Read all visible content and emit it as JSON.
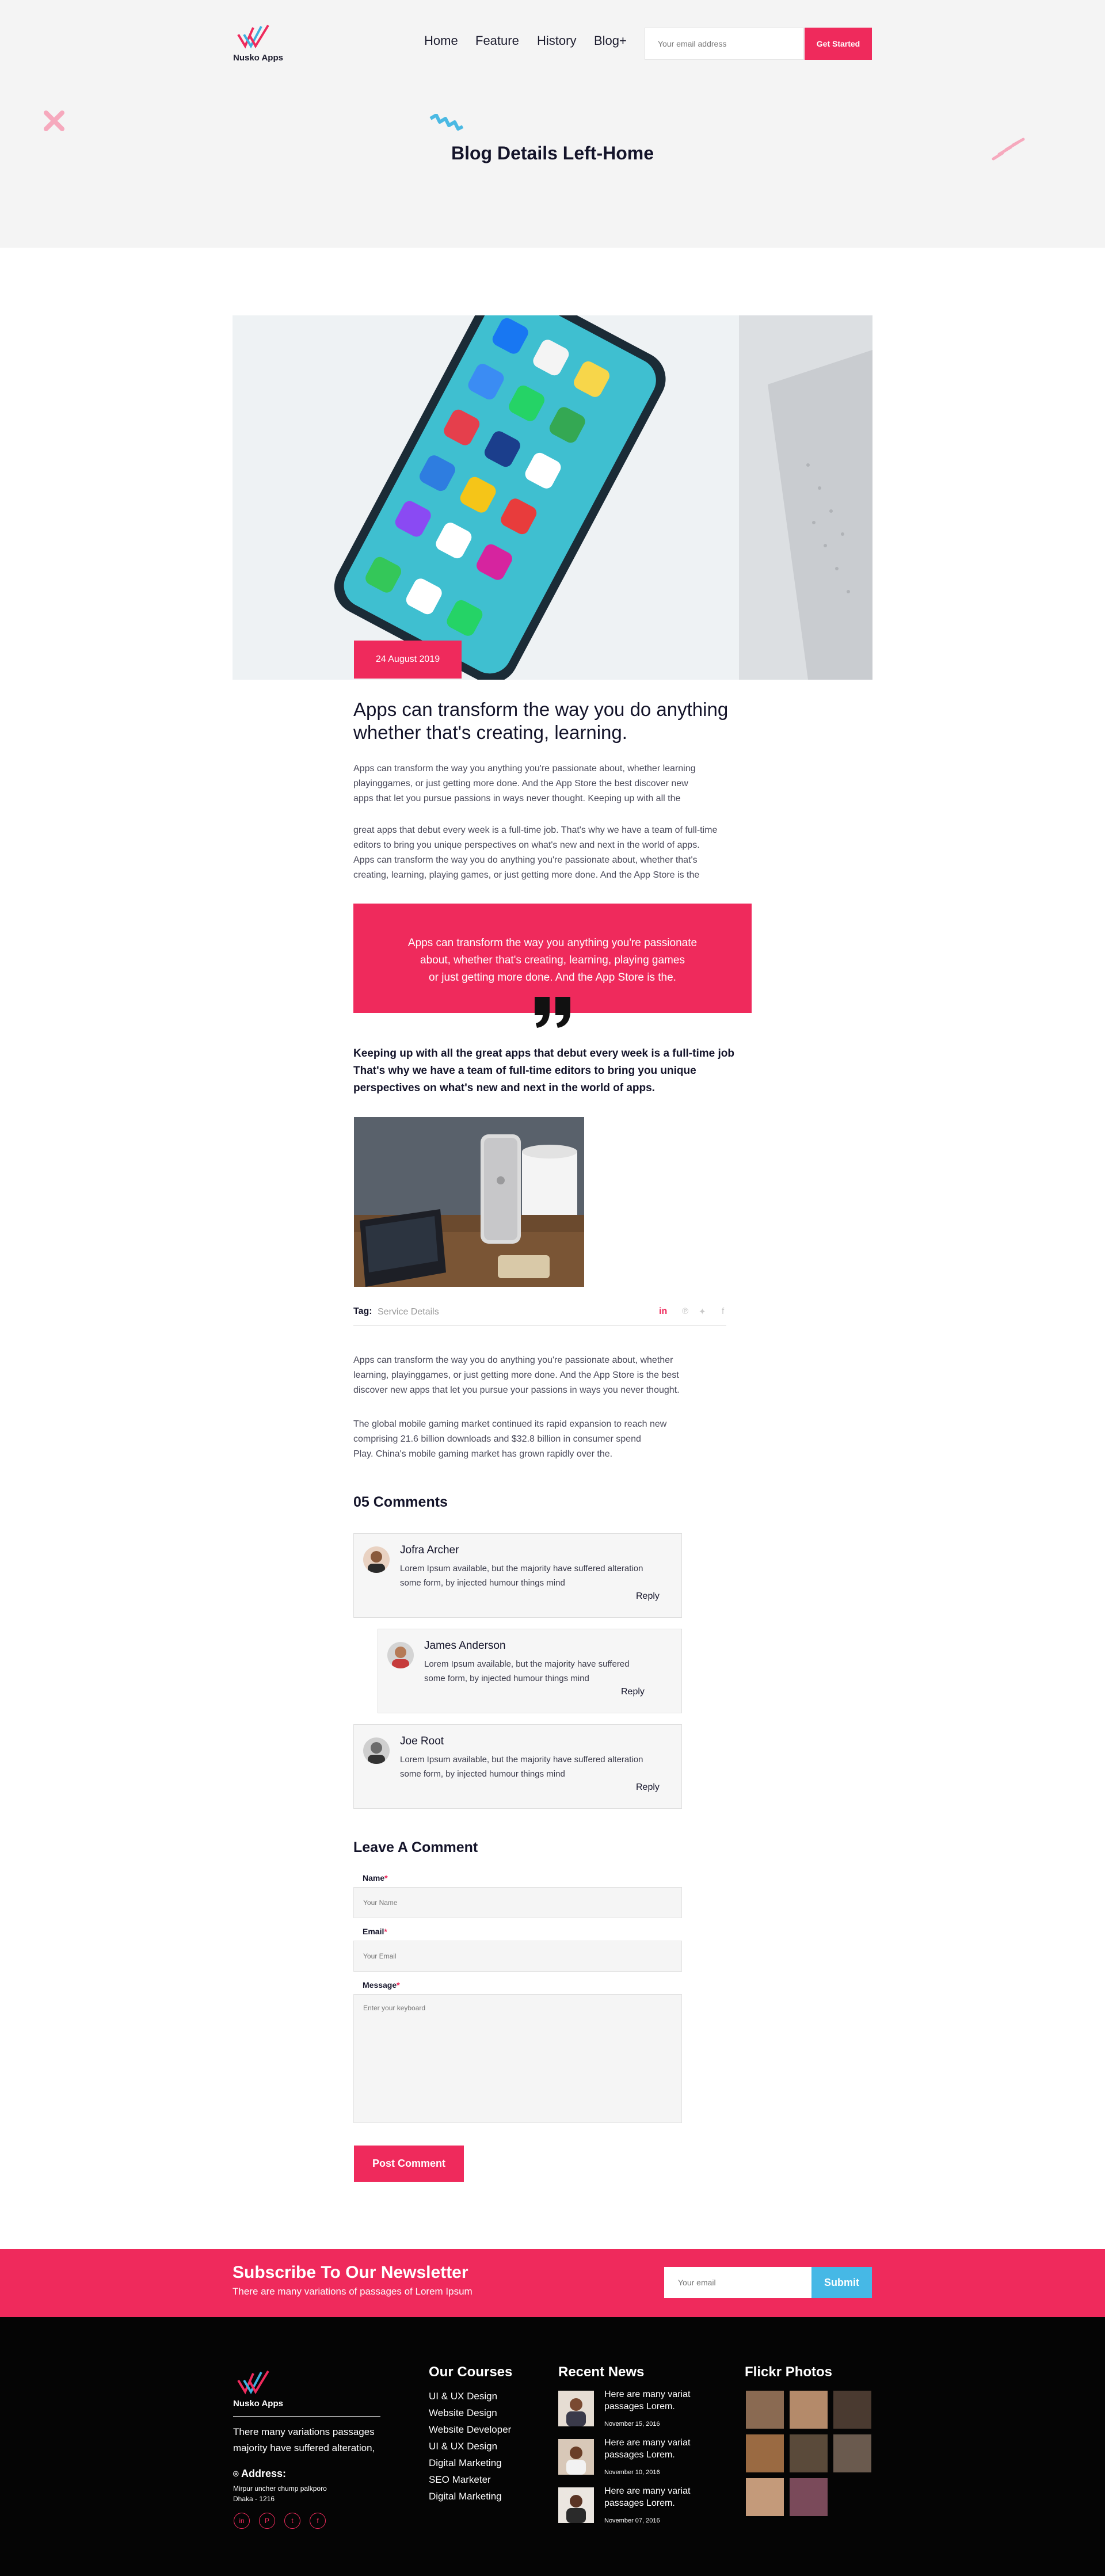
{
  "header": {
    "brand": "Nusko Apps",
    "nav": [
      "Home",
      "Feature",
      "History",
      "Blog+"
    ],
    "email_placeholder": "Your email address",
    "cta": "Get Started",
    "page_title": "Blog Details Left-Home"
  },
  "post": {
    "date": "24 August 2019",
    "title_line1": "Apps can transform the way you do anything",
    "title_line2": "whether that's creating, learning.",
    "para1": [
      "Apps can transform the way you anything you're passionate about, whether learning",
      "playinggames, or just getting more done. And the App Store the best discover new",
      "apps that let you pursue passions in ways never thought. Keeping up with all the"
    ],
    "para2": [
      "great apps that debut every week is a full-time job. That's why we have a team of full-time",
      "editors to bring you unique perspectives on what's new and next in the world of apps.",
      "Apps can transform the way you do anything you're passionate about, whether that's",
      "creating, learning, playing games, or just getting more done. And the App Store is the"
    ],
    "quote": [
      "Apps can transform the way you anything you're passionate",
      "about, whether that's creating, learning, playing games",
      "or just getting more done. And the App Store is the."
    ],
    "bold_para": [
      "Keeping up with all the great apps that debut every week is a full-time job",
      "That's why we have a team of full-time editors to bring you unique",
      "perspectives on what's new and next in the world of apps."
    ],
    "tag_label": "Tag:",
    "tag_value": "Service Details",
    "para3": [
      "Apps can transform the way you do anything you're passionate about, whether",
      "learning, playinggames, or just getting more done. And the App Store is the best",
      "discover new apps that let you pursue your passions in ways you never thought."
    ],
    "para4": [
      "The global mobile gaming market continued its rapid expansion to reach new",
      "comprising 21.6 billion downloads and $32.8 billion in consumer spend",
      "Play. China's mobile gaming market has grown rapidly over the."
    ]
  },
  "comments": {
    "heading": "05 Comments",
    "items": [
      {
        "name": "Jofra Archer",
        "line1": "Lorem Ipsum available, but the majority have suffered alteration",
        "line2": "some form, by injected humour things mind",
        "reply": "Reply"
      },
      {
        "name": "James Anderson",
        "line1": "Lorem Ipsum available, but the majority have suffered",
        "line2": "some form, by injected humour things mind",
        "reply": "Reply"
      },
      {
        "name": "Joe Root",
        "line1": "Lorem Ipsum available, but the majority have suffered alteration",
        "line2": "some form, by injected humour things mind",
        "reply": "Reply"
      }
    ]
  },
  "form": {
    "heading": "Leave A Comment",
    "name_label": "Name",
    "name_placeholder": "Your Name",
    "email_label": "Email",
    "email_placeholder": "Your Email",
    "message_label": "Message",
    "message_placeholder": "Enter your keyboard",
    "submit": "Post Comment"
  },
  "newsletter": {
    "title": "Subscribe To Our Newsletter",
    "subtitle": "There are many variations of passages of Lorem Ipsum",
    "placeholder": "Your email",
    "submit": "Submit"
  },
  "footer": {
    "brand": "Nusko Apps",
    "about": [
      "There many variations passages",
      "majority have suffered alteration,"
    ],
    "address_label": "Address:",
    "address": [
      "Mirpur uncher chump palkporo",
      "Dhaka - 1216"
    ],
    "courses_title": "Our Courses",
    "courses": [
      "UI & UX Design",
      "Website Design",
      "Website Developer",
      "UI & UX Design",
      "Digital Marketing",
      "SEO Marketer",
      "Digital Marketing"
    ],
    "news_title": "Recent News",
    "news": [
      {
        "title": "Here are many variat passages Lorem.",
        "date": "November 15, 2016"
      },
      {
        "title": "Here are many variat passages Lorem.",
        "date": "November 10, 2016"
      },
      {
        "title": "Here are many variat passages Lorem.",
        "date": "November 07, 2016"
      }
    ],
    "flickr_title": "Flickr Photos"
  },
  "icons": {
    "share": [
      "linkedin-icon",
      "pinterest-icon",
      "twitter-icon",
      "facebook-icon"
    ],
    "social": [
      "linkedin-icon",
      "pinterest-icon",
      "twitter-icon",
      "facebook-icon"
    ]
  },
  "colors": {
    "accent": "#ef2a5c",
    "dark": "#14142a",
    "footer_bg": "#050505",
    "newsletter_button": "#46b8e6"
  }
}
